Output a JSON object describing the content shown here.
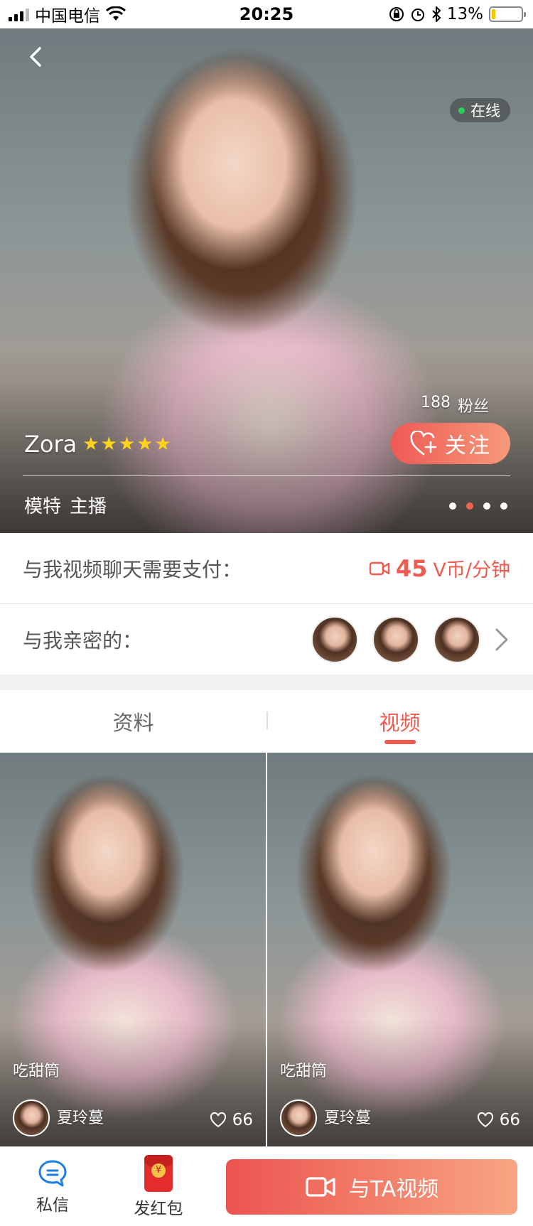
{
  "status_bar": {
    "carrier": "中国电信",
    "time": "20:25",
    "battery": "13%",
    "battery_level": 0.13
  },
  "hero": {
    "online_label": "在线",
    "fans_count": "188",
    "fans_label": "粉丝",
    "follow_label": "关注",
    "name": "Zora",
    "star_rating": 5,
    "tags": [
      "模特",
      "主播"
    ],
    "carousel_dots": 4,
    "carousel_active_index": 1,
    "colors": {
      "accent": "#f05b4f",
      "online": "#29d15a",
      "star": "#ffd21c"
    }
  },
  "price_row": {
    "label": "与我视频聊天需要支付：",
    "amount": "45",
    "unit": "V币/分钟",
    "icon": "video-camera-icon"
  },
  "intimate_row": {
    "label": "与我亲密的："
  },
  "tabs": [
    {
      "label": "资料",
      "active": false
    },
    {
      "label": "视频",
      "active": true
    }
  ],
  "videos": [
    {
      "title": "吃甜筒",
      "user": "夏玲蔓",
      "likes": "66"
    },
    {
      "title": "吃甜筒",
      "user": "夏玲蔓",
      "likes": "66"
    }
  ],
  "bottom_bar": {
    "message_label": "私信",
    "redpacket_label": "发红包",
    "cta_label": "与TA视频"
  }
}
